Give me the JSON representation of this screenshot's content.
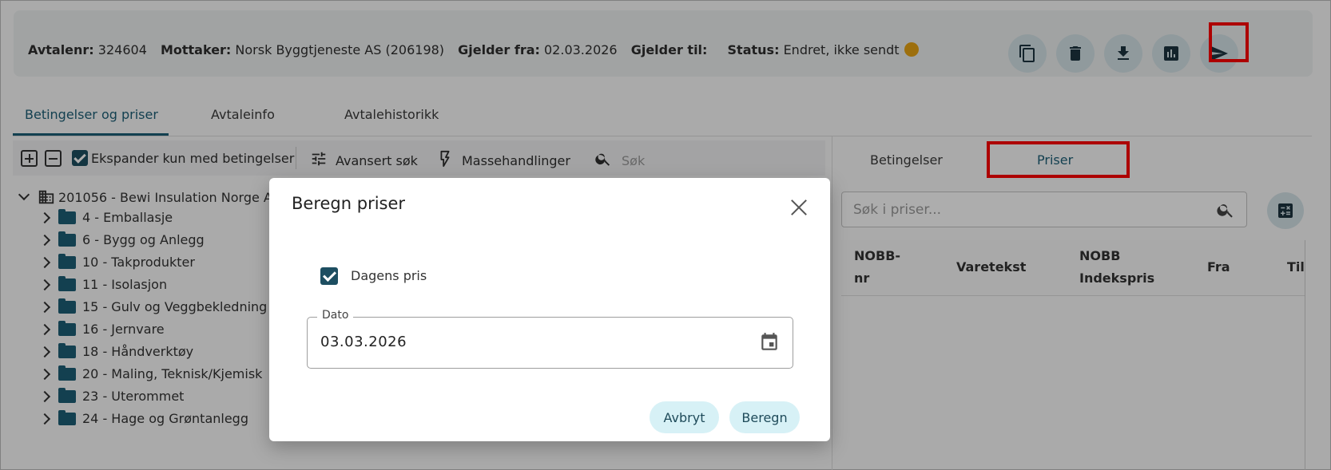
{
  "header": {
    "fields": [
      {
        "label": "Avtalenr:",
        "value": "324604"
      },
      {
        "label": "Mottaker:",
        "value": "Norsk Byggtjeneste AS (206198)"
      },
      {
        "label": "Gjelder fra:",
        "value": "02.03.2026"
      },
      {
        "label": "Gjelder til:",
        "value": ""
      },
      {
        "label": "Status:",
        "value": "Endret, ikke sendt"
      }
    ],
    "status_color": "#e8a414",
    "actions": [
      "copy-icon",
      "delete-icon",
      "download-icon",
      "report-chart-icon",
      "send-icon"
    ]
  },
  "tabs": [
    "Betingelser og priser",
    "Avtaleinfo",
    "Avtalehistorikk"
  ],
  "toolbar": {
    "expand_label": "Ekspander kun med betingelser",
    "advanced_search": "Avansert søk",
    "mass_actions": "Massehandlinger",
    "search_placeholder": "Søk"
  },
  "tree": {
    "root": "201056 - Bewi Insulation Norge AS",
    "items": [
      "4 - Emballasje",
      "6 - Bygg og Anlegg",
      "10 - Takprodukter",
      "11 - Isolasjon",
      "15 - Gulv og Veggbekledning",
      "16 - Jernvare",
      "18 - Håndverktøy",
      "20 - Maling, Teknisk/Kjemisk",
      "23 - Uterommet",
      "24 - Hage og Grøntanlegg"
    ]
  },
  "right_tabs": [
    "Betingelser",
    "Priser"
  ],
  "price_search_placeholder": "Søk i priser...",
  "price_table": {
    "headers": [
      "NOBB-nr",
      "Varetekst",
      "NOBB Indekspris",
      "Fra",
      "Til"
    ]
  },
  "dialog": {
    "title": "Beregn priser",
    "checkbox_label": "Dagens pris",
    "date_label": "Dato",
    "date_value": "03.03.2026",
    "cancel": "Avbryt",
    "submit": "Beregn"
  },
  "colors": {
    "accent": "#1d5f77",
    "highlight": "#ff0000",
    "pill_bg": "#d7f1f6"
  }
}
